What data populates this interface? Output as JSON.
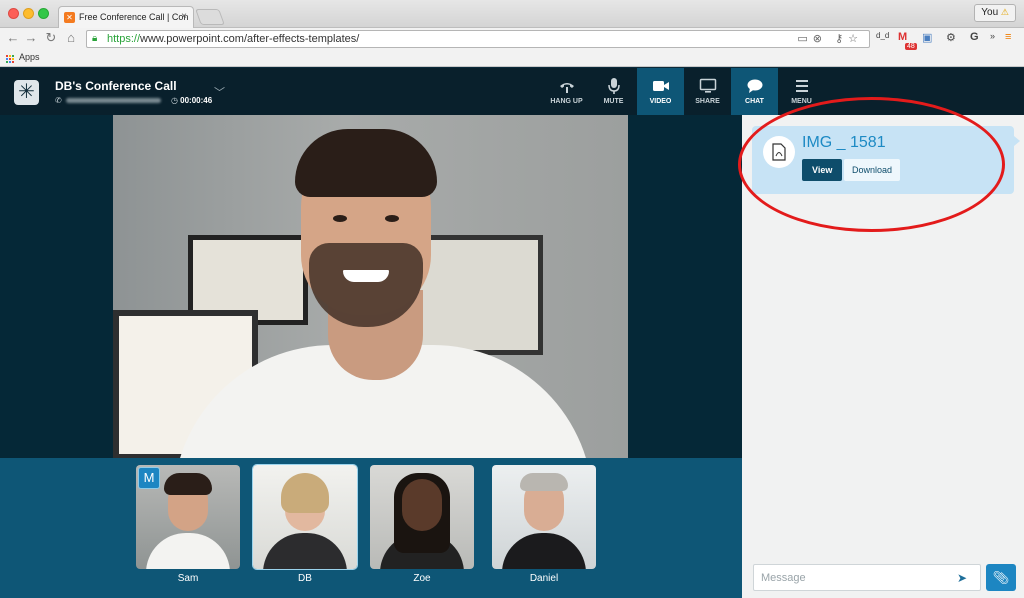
{
  "browser": {
    "tab_title": "Free Conference Call | Con",
    "tab_close": "×",
    "user_label": "You",
    "user_warning": "⚠",
    "url_scheme": "https://",
    "url_rest": "www.powerpoint.com/after-effects-templates/",
    "bookmarks_apps": "Apps",
    "ext_dd": "d_d",
    "gmail_count": "48",
    "ext_g": "G",
    "ext_more": "»"
  },
  "call": {
    "title": "DB's Conference Call",
    "timer": "00:00:46"
  },
  "controls": [
    {
      "label": "HANG UP",
      "active": false
    },
    {
      "label": "MUTE",
      "active": false
    },
    {
      "label": "VIDEO",
      "active": true
    },
    {
      "label": "SHARE",
      "active": false
    },
    {
      "label": "CHAT",
      "active": true
    },
    {
      "label": "MENU",
      "active": false
    }
  ],
  "participants": [
    {
      "name": "Sam",
      "moderator_badge": "M"
    },
    {
      "name": "DB"
    },
    {
      "name": "Zoe"
    },
    {
      "name": "Daniel"
    }
  ],
  "chat": {
    "file_name": "IMG _ 1581",
    "view_label": "View",
    "download_label": "Download",
    "message_placeholder": "Message"
  },
  "colors": {
    "header_bg": "#09202c",
    "active_control": "#0e5676",
    "strip_bg": "#0e5676",
    "accent": "#1d86c2",
    "highlight": "#e31b1b"
  }
}
